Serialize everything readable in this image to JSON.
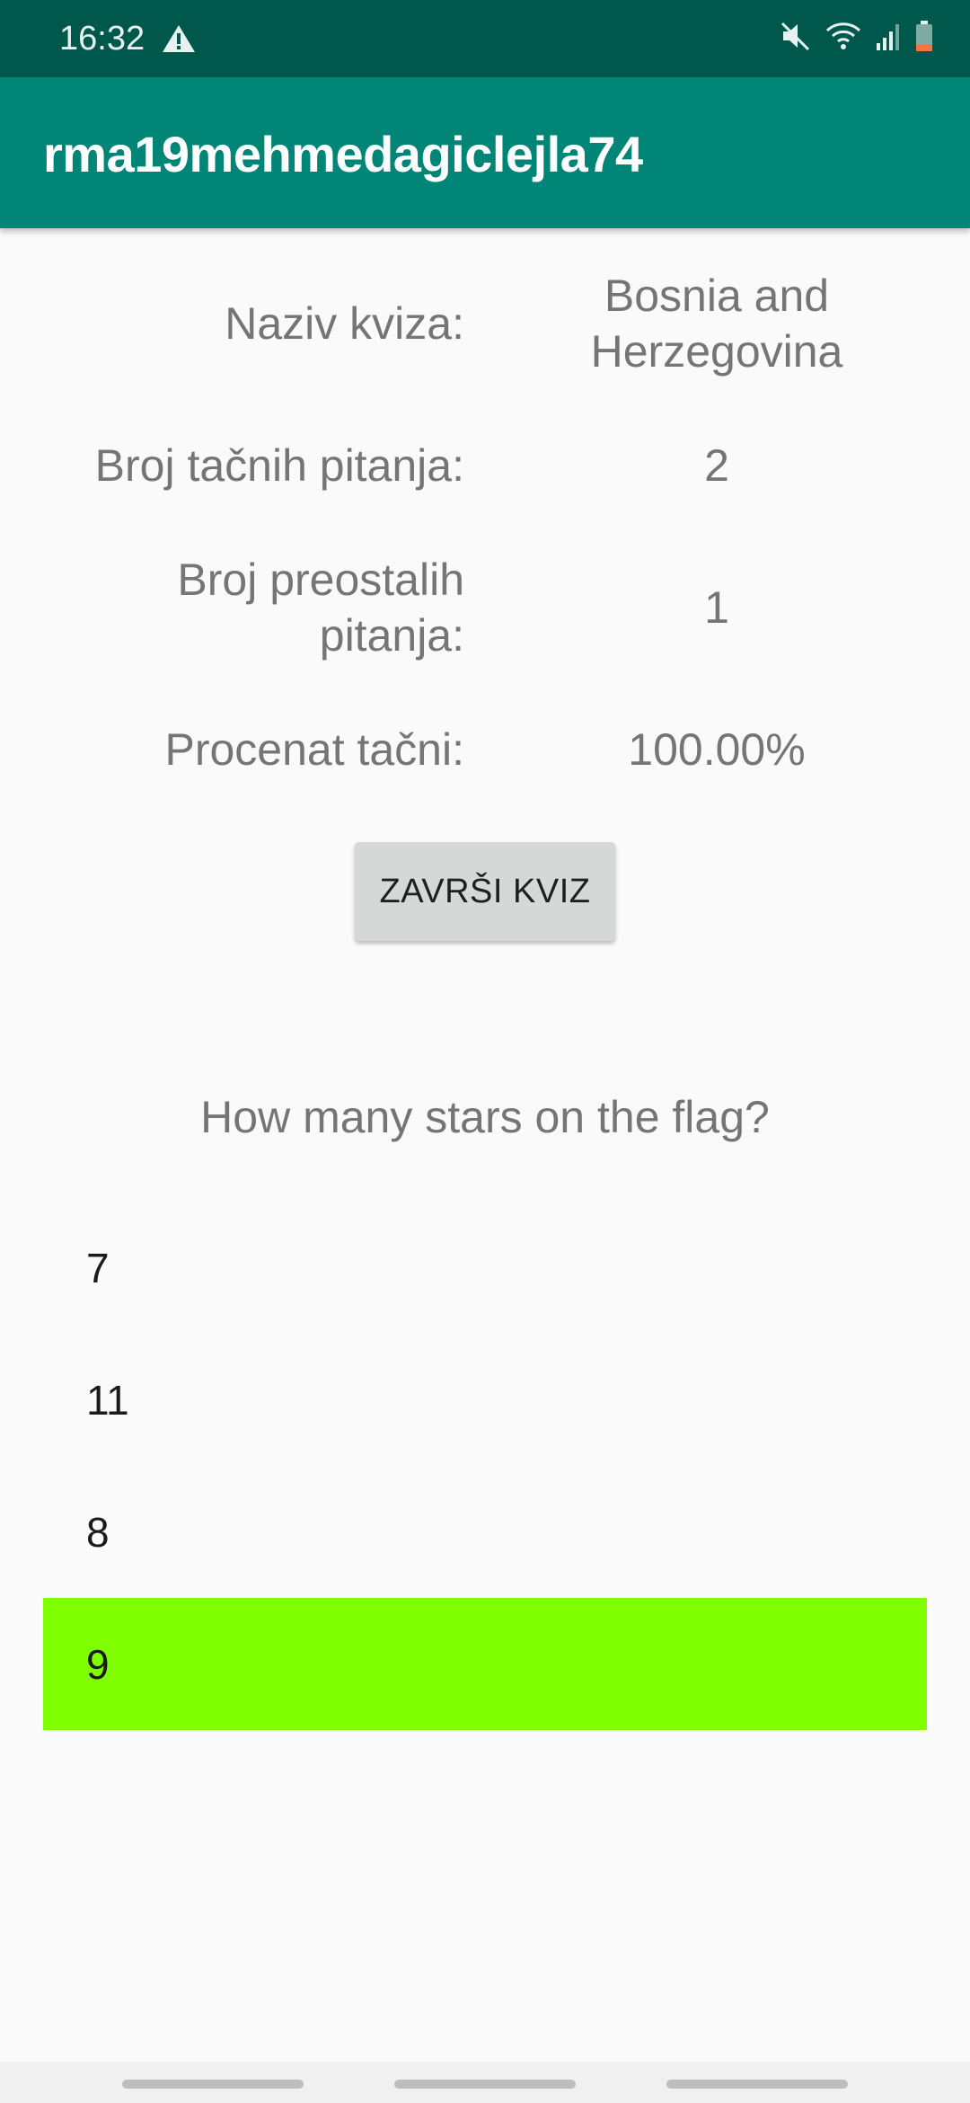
{
  "status_bar": {
    "time": "16:32",
    "icons": [
      "warning-icon",
      "mute-icon",
      "wifi-icon",
      "signal-icon",
      "battery-icon"
    ],
    "background": "#00574b"
  },
  "app_bar": {
    "title": "rma19mehmedagiclejla74",
    "background": "#008577"
  },
  "quiz_info": {
    "name_label": "Naziv kviza:",
    "name_value": "Bosnia and Herzegovina",
    "correct_label": "Broj tačnih pitanja:",
    "correct_value": "2",
    "remaining_label": "Broj preostalih pitanja:",
    "remaining_value": "1",
    "percent_label": "Procenat tačni:",
    "percent_value": "100.00%"
  },
  "finish_button": {
    "label": "ZAVRŠI KVIZ"
  },
  "question": {
    "text": "How many stars on the flag?"
  },
  "answers": [
    {
      "label": "7",
      "selected": false
    },
    {
      "label": "11",
      "selected": false
    },
    {
      "label": "8",
      "selected": false
    },
    {
      "label": "9",
      "selected": true
    }
  ],
  "colors": {
    "selected_answer": "#7fff00",
    "secondary_text": "#757575"
  }
}
